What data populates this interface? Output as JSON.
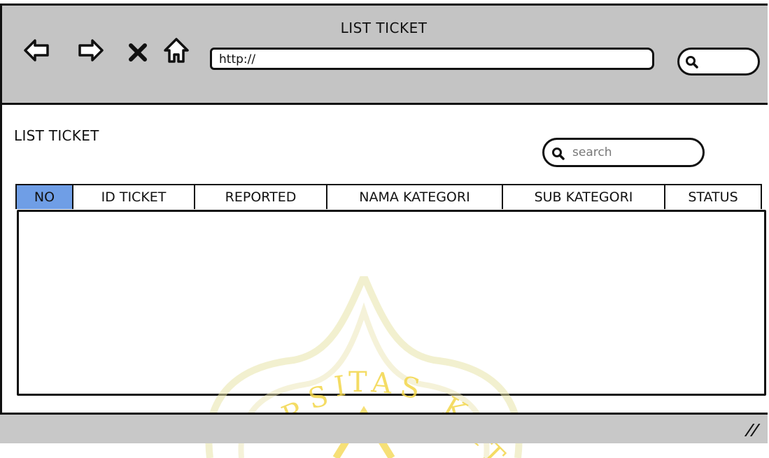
{
  "window": {
    "title": "LIST TICKET",
    "url": "http://"
  },
  "nav": {
    "back_icon": "back-arrow-icon",
    "forward_icon": "forward-arrow-icon",
    "stop_icon": "close-icon",
    "home_icon": "home-icon"
  },
  "page": {
    "title": "LIST TICKET",
    "search_placeholder": "search"
  },
  "table": {
    "columns": [
      {
        "label": "NO",
        "active": true
      },
      {
        "label": "ID TICKET",
        "active": false
      },
      {
        "label": "REPORTED",
        "active": false
      },
      {
        "label": "NAMA KATEGORI",
        "active": false
      },
      {
        "label": "SUB KATEGORI",
        "active": false
      },
      {
        "label": "STATUS",
        "active": false
      }
    ]
  },
  "watermark": {
    "text": "ERSITAS KAT"
  },
  "colors": {
    "chrome": "#c4c4c4",
    "active_tab": "#6f9ee6",
    "watermark": "#f3d64a"
  }
}
